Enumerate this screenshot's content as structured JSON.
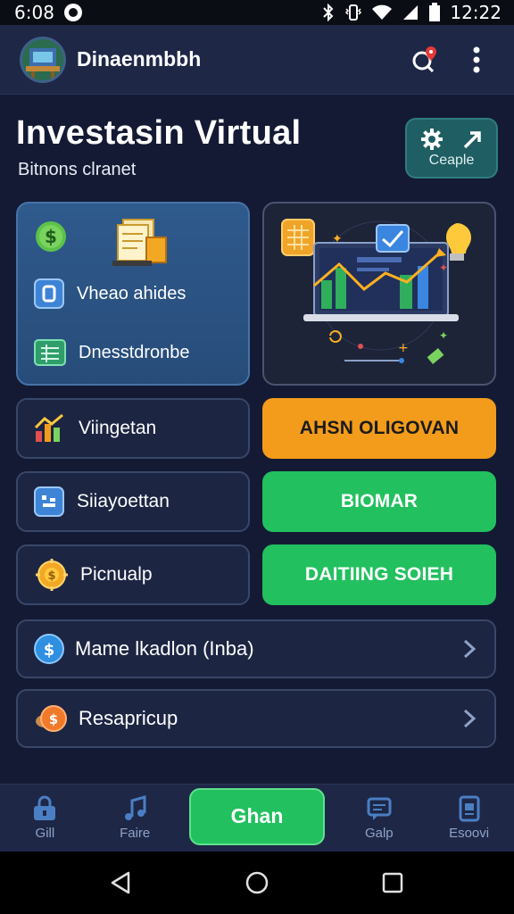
{
  "status": {
    "time": "6:08",
    "clock": "12:22"
  },
  "appbar": {
    "name": "Dinaenmbbh"
  },
  "hero": {
    "title": "Investasin Virtual",
    "subtitle": "Bitnons clranet",
    "button_label": "Ceaple"
  },
  "card": {
    "items": [
      {
        "label": "Vheao ahides"
      },
      {
        "label": "Dnesstdronbe"
      }
    ]
  },
  "tiles": [
    {
      "label": "Viingetan",
      "icon": "chart-icon"
    },
    {
      "label": "Siiayoettan",
      "icon": "grid-icon"
    },
    {
      "label": "Picnualp",
      "icon": "coins-icon"
    }
  ],
  "buttons": [
    {
      "label": "AHSN OLIGOVAN",
      "color": "#f39c1b"
    },
    {
      "label": "BIOMAR",
      "color": "#22c05f"
    },
    {
      "label": "DAITIING SOIEH",
      "color": "#22c05f"
    }
  ],
  "list": [
    {
      "label": "Mame lkadlon (Inba)"
    },
    {
      "label": "Resapricup"
    }
  ],
  "nav": {
    "items": [
      {
        "label": "Gill"
      },
      {
        "label": "Faire"
      },
      {
        "label": "Galp"
      },
      {
        "label": "Esoovi"
      }
    ],
    "center": "Ghan"
  },
  "colors": {
    "accent_green": "#22c05f",
    "accent_orange": "#f39c1b",
    "background": "#141a33"
  }
}
